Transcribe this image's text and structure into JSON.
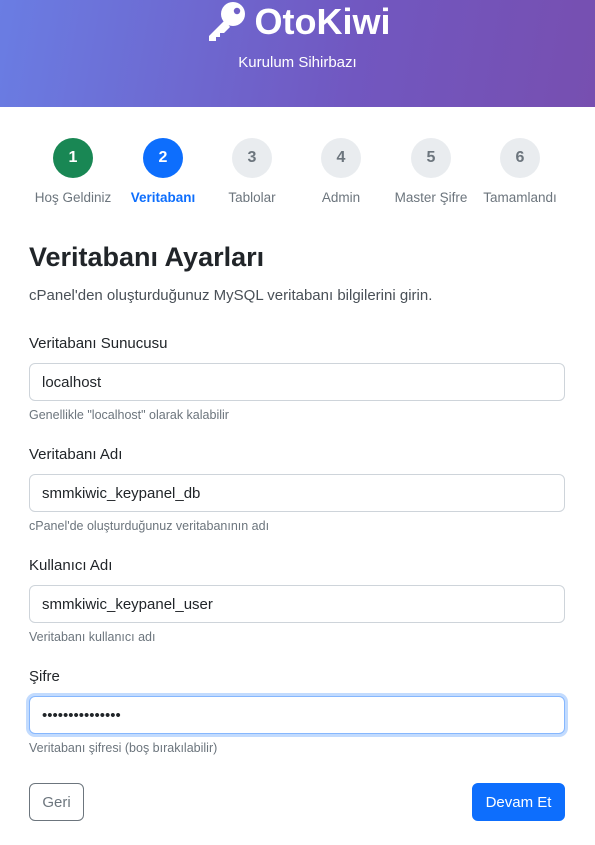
{
  "header": {
    "app_name": "OtoKiwi",
    "subtitle": "Kurulum Sihirbazı",
    "logo_icon": "key-icon",
    "gradient_start": "#6a7de3",
    "gradient_end": "#774fb0"
  },
  "steps": [
    {
      "number": "1",
      "label": "Hoş Geldiniz",
      "state": "completed"
    },
    {
      "number": "2",
      "label": "Veritabanı",
      "state": "active"
    },
    {
      "number": "3",
      "label": "Tablolar",
      "state": "pending"
    },
    {
      "number": "4",
      "label": "Admin",
      "state": "pending"
    },
    {
      "number": "5",
      "label": "Master Şifre",
      "state": "pending"
    },
    {
      "number": "6",
      "label": "Tamamlandı",
      "state": "pending"
    }
  ],
  "colors": {
    "completed": "#198754",
    "active": "#0d6efd",
    "pending": "#e9ecef"
  },
  "section": {
    "title": "Veritabanı Ayarları",
    "description": "cPanel'den oluşturduğunuz MySQL veritabanı bilgilerini girin."
  },
  "fields": {
    "db_host": {
      "label": "Veritabanı Sunucusu",
      "value": "localhost",
      "help": "Genellikle \"localhost\" olarak kalabilir"
    },
    "db_name": {
      "label": "Veritabanı Adı",
      "value": "smmkiwic_keypanel_db",
      "help": "cPanel'de oluşturduğunuz veritabanının adı"
    },
    "db_user": {
      "label": "Kullanıcı Adı",
      "value": "smmkiwic_keypanel_user",
      "help": "Veritabanı kullanıcı adı"
    },
    "db_pass": {
      "label": "Şifre",
      "value": "•••••••••••••••",
      "help": "Veritabanı şifresi (boş bırakılabilir)"
    }
  },
  "buttons": {
    "back": "Geri",
    "next": "Devam Et"
  }
}
